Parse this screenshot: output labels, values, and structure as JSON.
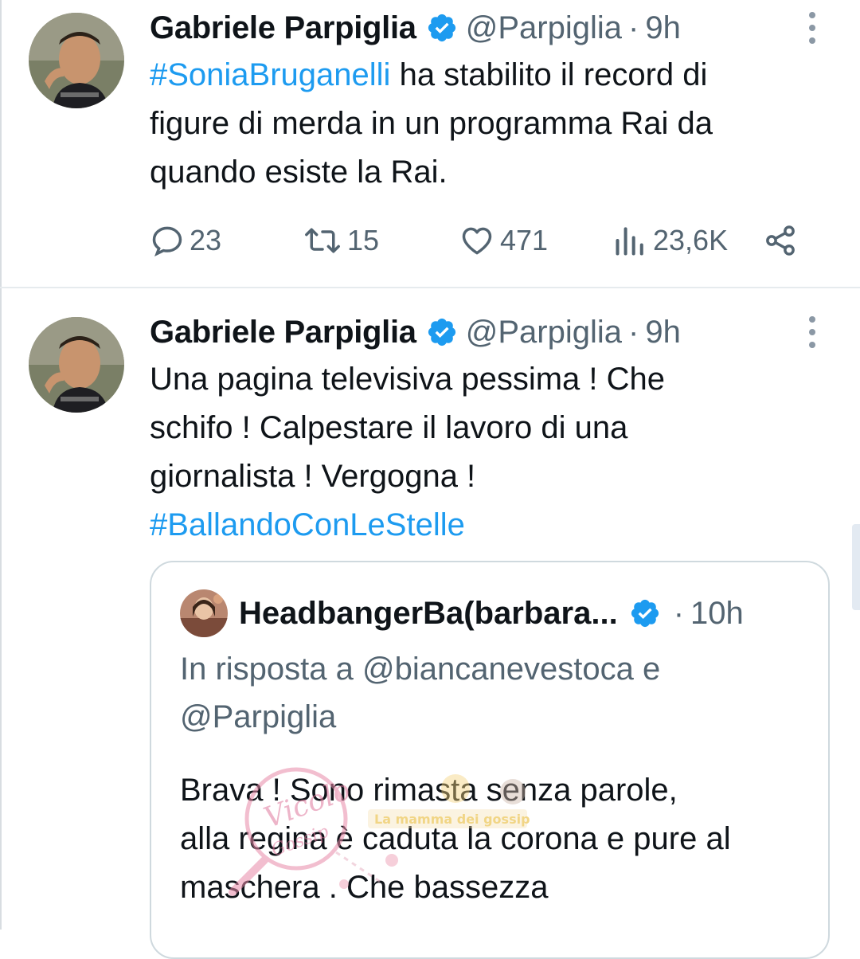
{
  "colors": {
    "accent": "#1d9bf0",
    "text": "#0f1419",
    "secondary": "#536471",
    "border": "#cfd9de"
  },
  "tweets": [
    {
      "author": {
        "display_name": "Gabriele Parpiglia",
        "handle": "@Parpiglia",
        "separator": "·",
        "time": "9h",
        "verified": true,
        "avatar_icon": "profile-photo"
      },
      "text": {
        "hashtag": "#SoniaBruganelli",
        "line1_rest": " ha stabilito il record di",
        "line2": "figure di merda in un programma Rai da",
        "line3": "quando esiste la Rai."
      },
      "stats": {
        "replies": "23",
        "reposts": "15",
        "likes": "471",
        "views": "23,6K"
      }
    },
    {
      "author": {
        "display_name": "Gabriele Parpiglia",
        "handle": "@Parpiglia",
        "separator": "·",
        "time": "9h",
        "verified": true,
        "avatar_icon": "profile-photo"
      },
      "text": {
        "line1": "Una pagina televisiva pessima ! Che",
        "line2": "schifo ! Calpestare il lavoro di una",
        "line3": "giornalista ! Vergogna !",
        "hashtag": "#BallandoConLeStelle"
      },
      "quote": {
        "author": {
          "display_name": "HeadbangerBa(barbara...",
          "separator": "·",
          "time": "10h",
          "verified": true,
          "avatar_icon": "profile-photo"
        },
        "reply_to": {
          "line1": "In risposta a @biancanevestoca e",
          "line2": "@Parpiglia"
        },
        "text": {
          "line1": "Brava ! Sono rimasta senza parole,",
          "line2": "alla regina è caduta la corona e pure al",
          "line3": "maschera . Che bassezza"
        }
      }
    }
  ],
  "watermark_text": {
    "script": "Vicolo Gossip",
    "banner": "La mamma dei gossip"
  }
}
